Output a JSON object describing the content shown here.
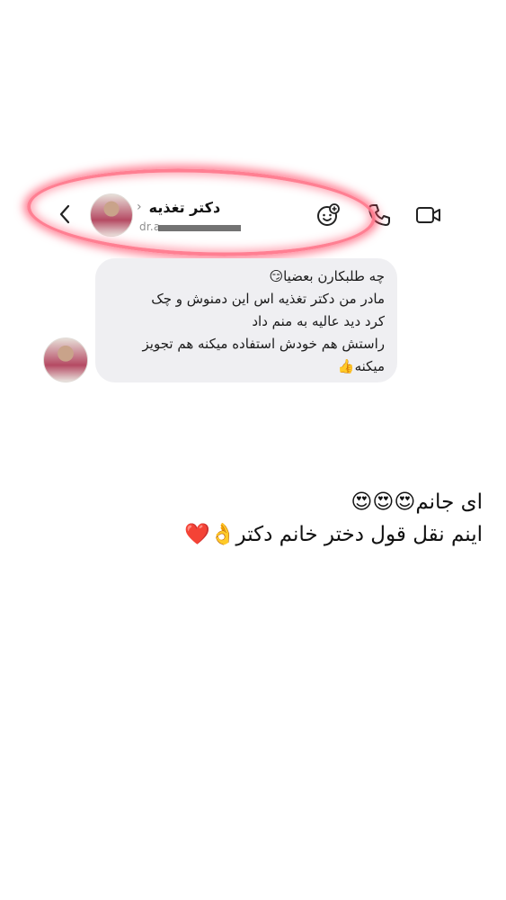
{
  "header": {
    "contact_name": "دکتر تغذیه",
    "chevron": "›",
    "username": "dr.a",
    "back_icon": "chevron-left-icon",
    "actions": [
      "video-call-icon",
      "phone-call-icon",
      "face-effect-icon"
    ]
  },
  "highlight": {
    "color": "#ff5a78"
  },
  "message": {
    "lines": [
      "چه طلبکارن بعضیا😏",
      "مادر من دکتر تغذیه اس این دمنوش و چک",
      "کرد دید عالیه به منم داد",
      "راستش هم خودش استفاده میکنه هم تجویز",
      "میکنه👍"
    ],
    "bubble_color": "#efeff2"
  },
  "caption": {
    "line1": "ای جانم😍😍😍",
    "line2": "اینم نقل قول دختر خانم دکتر👌❤️"
  }
}
